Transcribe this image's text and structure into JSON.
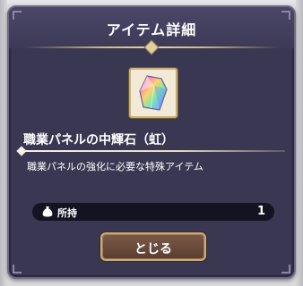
{
  "dialog": {
    "title": "アイテム詳細",
    "item": {
      "icon": "rainbow-crystal-icon",
      "name": "職業パネルの中輝石（虹）",
      "description": "職業パネルの強化に必要な特殊アイテム"
    },
    "owned": {
      "icon": "bag-icon",
      "label": "所持",
      "count": "1"
    },
    "close_label": "とじる"
  },
  "colors": {
    "panel": "#3a3752",
    "accent_gold": "#cdb681",
    "button": "#6b4b3c"
  }
}
